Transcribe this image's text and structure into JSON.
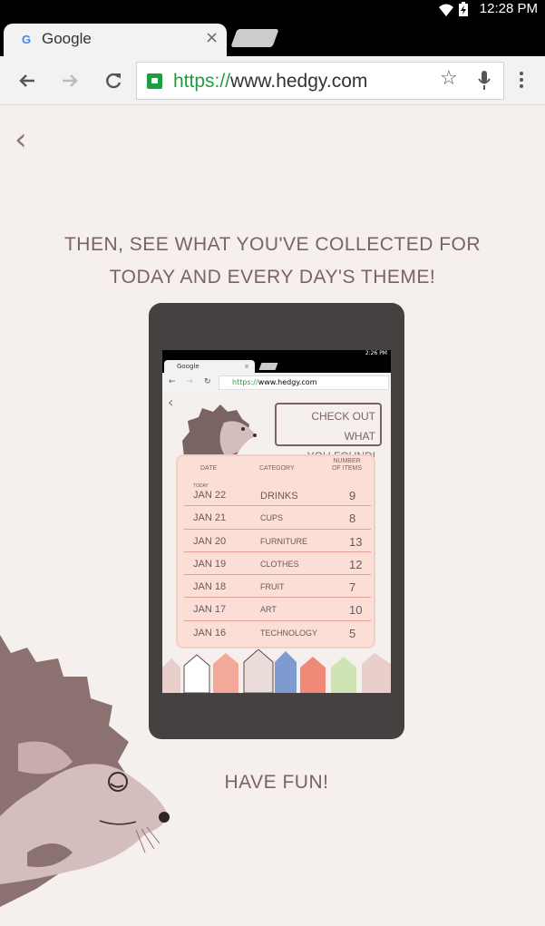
{
  "status": {
    "time": "12:28 PM",
    "icons": [
      "wifi-icon",
      "battery-icon"
    ]
  },
  "browser": {
    "tab_title": "Google",
    "tab_close": "×",
    "url_scheme": "https://",
    "url_host": "www.hedgy.com",
    "icons": [
      "back-arrow-icon",
      "forward-arrow-icon",
      "reload-icon",
      "lock-icon",
      "star-icon",
      "mic-icon",
      "more-vert-icon"
    ]
  },
  "page": {
    "back": "‹",
    "heading": "THEN, SEE WHAT YOU'VE COLLECTED FOR TODAY AND EVERY DAY'S THEME!",
    "footer": "HAVE FUN!"
  },
  "inner_screen": {
    "status_time": "2:26 PM",
    "tab_title": "Google",
    "url_scheme": "https://",
    "url_host": "www.hedgy.com",
    "bubble_line1": "CHECK OUT WHAT",
    "bubble_line2": "YOU FOUND!",
    "columns": {
      "date": "DATE",
      "category": "CATEGORY",
      "count_line1": "NUMBER",
      "count_line2": "OF ITEMS"
    },
    "today_label": "TODAY",
    "rows": [
      {
        "date": "JAN 22",
        "category": "DRINKS",
        "count": "9"
      },
      {
        "date": "JAN 21",
        "category": "CUPS",
        "count": "8"
      },
      {
        "date": "JAN 20",
        "category": "FURNITURE",
        "count": "13"
      },
      {
        "date": "JAN 19",
        "category": "CLOTHES",
        "count": "12"
      },
      {
        "date": "JAN 18",
        "category": "FRUIT",
        "count": "7"
      },
      {
        "date": "JAN 17",
        "category": "ART",
        "count": "10"
      },
      {
        "date": "JAN 16",
        "category": "TECHNOLOGY",
        "count": "5"
      }
    ]
  },
  "colors": {
    "background": "#f5efee",
    "text": "#7b6460",
    "device": "#444140",
    "card": "#fbdfd6",
    "secure_green": "#1e9e3e"
  }
}
